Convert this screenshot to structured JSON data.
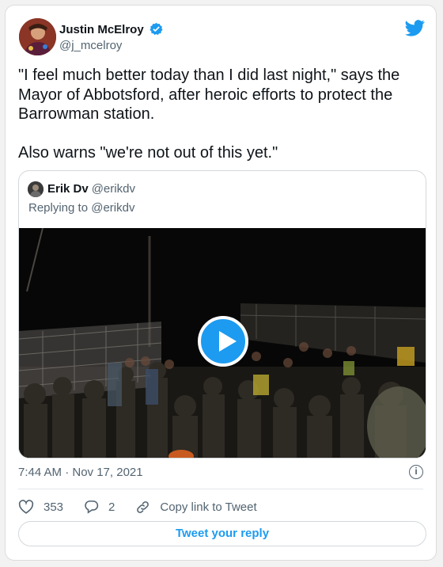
{
  "author": {
    "name": "Justin McElroy",
    "handle": "@j_mcelroy"
  },
  "tweet": {
    "text": "\"I feel much better today than I did last night,\" says the Mayor of Abbotsford, after heroic efforts to protect the Barrowman station.\n\nAlso warns \"we're not out of this yet.\"",
    "timestamp": "7:44 AM · Nov 17, 2021"
  },
  "quoted": {
    "name": "Erik Dv",
    "handle": "@erikdv",
    "replying_to": "Replying to @erikdv"
  },
  "actions": {
    "likes": "353",
    "replies": "2",
    "copy_link_label": "Copy link to Tweet"
  },
  "reply_button_label": "Tweet your reply",
  "colors": {
    "accent": "#1d9bf0",
    "secondary_text": "#536471"
  },
  "icons": [
    "verified-badge-icon",
    "twitter-bird-icon",
    "play-icon",
    "info-icon",
    "heart-icon",
    "reply-icon",
    "link-icon"
  ]
}
